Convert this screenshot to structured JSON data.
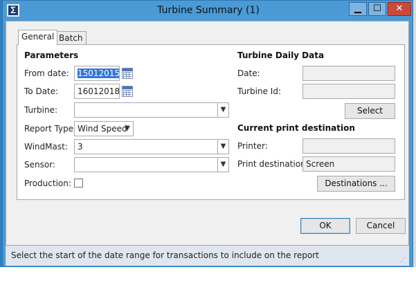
{
  "window": {
    "title": "Turbine Summary (1)",
    "app_icon_glyph": "∑"
  },
  "tabs": [
    {
      "label": "General",
      "active": true
    },
    {
      "label": "Batch",
      "active": false
    }
  ],
  "parameters": {
    "heading": "Parameters",
    "from_date_label": "From date:",
    "from_date_value": "15012015",
    "to_date_label": "To Date:",
    "to_date_value": "16012018",
    "turbine_label": "Turbine:",
    "turbine_value": "",
    "report_type_label": "Report Type:",
    "report_type_value": "Wind Speed",
    "windmast_label": "WindMast:",
    "windmast_value": "3",
    "sensor_label": "Sensor:",
    "sensor_value": "",
    "production_label": "Production:",
    "production_checked": false
  },
  "daily_data": {
    "heading": "Turbine Daily Data",
    "date_label": "Date:",
    "date_value": "",
    "turbine_id_label": "Turbine Id:",
    "turbine_id_value": "",
    "select_button": "Select"
  },
  "print": {
    "heading": "Current print destination",
    "printer_label": "Printer:",
    "printer_value": "",
    "destination_label": "Print destination:",
    "destination_value": "Screen",
    "destinations_button": "Destinations ..."
  },
  "footer": {
    "ok_label": "OK",
    "cancel_label": "Cancel"
  },
  "status": {
    "text": "Select the start of the date range for transactions to include on the report"
  },
  "icons": {
    "dropdown": "chevron-down-icon",
    "calendar": "calendar-icon",
    "minimize": "minimize-icon",
    "maximize": "maximize-icon",
    "close": "close-icon",
    "grip": "resize-grip-icon"
  },
  "colors": {
    "title_bar": "#4a9ad6",
    "close_button": "#c94a3a",
    "selection": "#3375d7"
  }
}
